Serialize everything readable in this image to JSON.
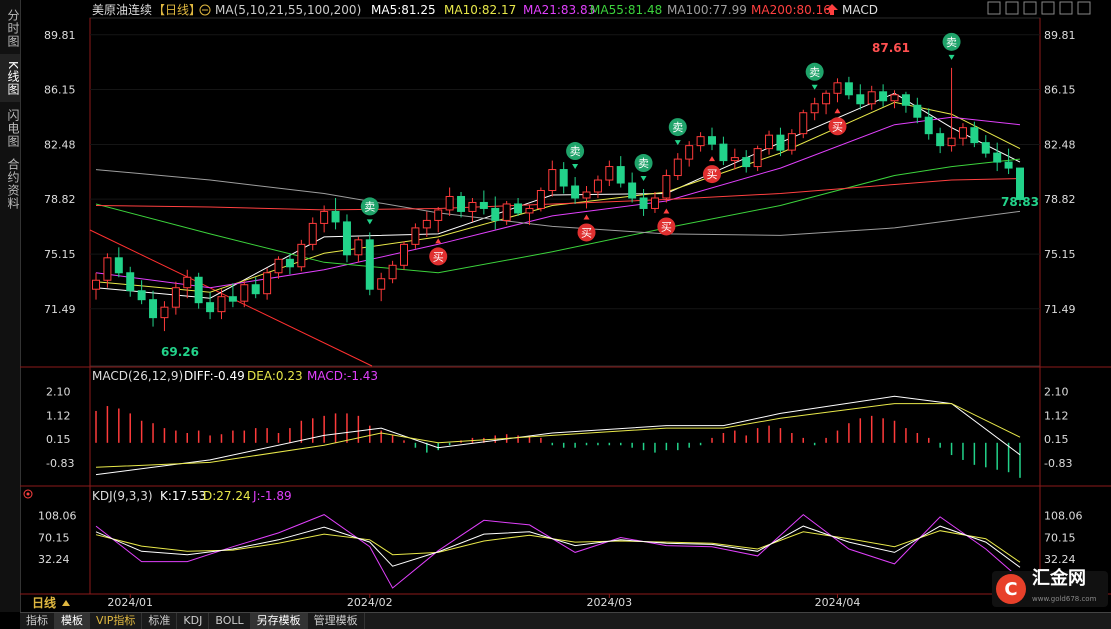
{
  "sidebar": {
    "tabs": [
      "分时图",
      "K线图",
      "闪电图",
      "合约资料"
    ]
  },
  "header": {
    "title": "美原油连续",
    "period_tag": "【日线】",
    "ma_label": "MA(5,10,21,55,100,200)",
    "ma5": "MA5:81.25",
    "ma10": "MA10:82.17",
    "ma21": "MA21:83.83",
    "ma55": "MA55:81.48",
    "ma100": "MA100:77.99",
    "ma200": "MA200:80.16",
    "indicator": "MACD"
  },
  "macd_header": {
    "label": "MACD(26,12,9)",
    "diff": "DIFF:-0.49",
    "dea": "DEA:0.23",
    "macd": "MACD:-1.43"
  },
  "kdj_header": {
    "label": "KDJ(9,3,3)",
    "k": "K:17.53",
    "d": "D:27.24",
    "j": "J:-1.89"
  },
  "footer": {
    "period": "日线",
    "tabs": [
      "指标",
      "模板",
      "VIP指标",
      "标准",
      "KDJ",
      "BOLL",
      "另存模板",
      "管理模板"
    ]
  },
  "logo": {
    "name": "汇金网",
    "url": "www.gold678.com"
  },
  "colors": {
    "up": "#ff3b3b",
    "down": "#22d38a",
    "ma5": "#ffffff",
    "ma10": "#e8e84a",
    "ma21": "#e040fb",
    "ma55": "#3cd23c",
    "ma100": "#9e9e9e",
    "ma200": "#ff4040"
  },
  "chart_data": [
    {
      "type": "candlestick",
      "title": "美原油连续【日线】",
      "x_ticks": [
        "2024/01",
        "2024/02",
        "2024/03",
        "2024/04"
      ],
      "y_ticks": [
        89.81,
        86.15,
        82.48,
        78.82,
        75.15,
        71.49
      ],
      "ylim": [
        67.8,
        90.8
      ],
      "annotations": {
        "high": "87.61",
        "low": "69.26",
        "last": "78.83"
      },
      "buy_label": "买",
      "sell_label": "卖",
      "signals": [
        {
          "i": 24,
          "t": "sell"
        },
        {
          "i": 30,
          "t": "buy"
        },
        {
          "i": 42,
          "t": "sell"
        },
        {
          "i": 43,
          "t": "buy"
        },
        {
          "i": 48,
          "t": "sell"
        },
        {
          "i": 50,
          "t": "buy"
        },
        {
          "i": 51,
          "t": "sell"
        },
        {
          "i": 54,
          "t": "buy"
        },
        {
          "i": 63,
          "t": "sell"
        },
        {
          "i": 65,
          "t": "buy"
        },
        {
          "i": 75,
          "t": "sell"
        }
      ],
      "candles": [
        [
          72.8,
          73.9,
          72.1,
          73.4
        ],
        [
          73.4,
          75.2,
          72.9,
          74.9
        ],
        [
          74.9,
          75.6,
          73.6,
          73.9
        ],
        [
          73.9,
          74.3,
          72.3,
          72.7
        ],
        [
          72.7,
          73.4,
          71.8,
          72.1
        ],
        [
          72.1,
          72.7,
          70.3,
          70.9
        ],
        [
          70.9,
          72.0,
          70.0,
          71.6
        ],
        [
          71.6,
          73.3,
          71.1,
          72.9
        ],
        [
          72.9,
          74.1,
          72.2,
          73.6
        ],
        [
          73.6,
          73.9,
          71.5,
          71.9
        ],
        [
          71.9,
          72.6,
          70.8,
          71.3
        ],
        [
          71.3,
          72.8,
          70.8,
          72.3
        ],
        [
          72.3,
          73.2,
          71.6,
          72.0
        ],
        [
          72.0,
          73.4,
          71.6,
          73.1
        ],
        [
          73.1,
          73.6,
          72.2,
          72.5
        ],
        [
          72.5,
          74.2,
          72.1,
          73.9
        ],
        [
          73.9,
          75.0,
          73.5,
          74.8
        ],
        [
          74.8,
          75.2,
          73.8,
          74.3
        ],
        [
          74.3,
          76.1,
          74.0,
          75.8
        ],
        [
          75.8,
          77.6,
          75.4,
          77.2
        ],
        [
          77.2,
          78.4,
          76.6,
          78.0
        ],
        [
          78.0,
          78.9,
          76.8,
          77.3
        ],
        [
          77.3,
          77.8,
          74.6,
          75.1
        ],
        [
          75.1,
          76.3,
          74.6,
          76.1
        ],
        [
          76.1,
          76.6,
          72.4,
          72.8
        ],
        [
          72.8,
          73.9,
          72.0,
          73.5
        ],
        [
          73.5,
          74.7,
          73.2,
          74.4
        ],
        [
          74.4,
          76.0,
          74.1,
          75.8
        ],
        [
          75.8,
          77.2,
          75.5,
          76.9
        ],
        [
          76.9,
          78.0,
          76.3,
          77.4
        ],
        [
          77.4,
          78.3,
          76.6,
          78.1
        ],
        [
          78.1,
          79.6,
          77.7,
          79.0
        ],
        [
          79.0,
          79.3,
          77.6,
          78.0
        ],
        [
          78.0,
          78.9,
          77.3,
          78.6
        ],
        [
          78.6,
          79.4,
          77.8,
          78.2
        ],
        [
          78.2,
          79.0,
          76.8,
          77.4
        ],
        [
          77.4,
          78.7,
          77.1,
          78.5
        ],
        [
          78.5,
          78.9,
          77.7,
          77.9
        ],
        [
          77.9,
          78.4,
          77.1,
          78.2
        ],
        [
          78.2,
          79.6,
          78.0,
          79.4
        ],
        [
          79.4,
          81.4,
          79.0,
          80.8
        ],
        [
          80.8,
          81.3,
          79.2,
          79.7
        ],
        [
          79.7,
          80.3,
          78.5,
          78.9
        ],
        [
          78.9,
          79.7,
          78.2,
          79.3
        ],
        [
          79.3,
          80.4,
          78.9,
          80.1
        ],
        [
          80.1,
          81.4,
          79.7,
          81.0
        ],
        [
          81.0,
          81.7,
          79.6,
          79.9
        ],
        [
          79.9,
          80.6,
          78.6,
          78.9
        ],
        [
          78.9,
          79.5,
          77.7,
          78.2
        ],
        [
          78.2,
          79.3,
          77.9,
          78.9
        ],
        [
          78.9,
          80.8,
          78.6,
          80.4
        ],
        [
          80.4,
          81.9,
          80.1,
          81.5
        ],
        [
          81.5,
          82.7,
          81.0,
          82.4
        ],
        [
          82.4,
          83.3,
          82.0,
          83.0
        ],
        [
          83.0,
          83.6,
          82.1,
          82.5
        ],
        [
          82.5,
          83.0,
          81.1,
          81.4
        ],
        [
          81.4,
          82.2,
          80.8,
          81.6
        ],
        [
          81.6,
          82.1,
          80.6,
          81.0
        ],
        [
          81.0,
          82.4,
          80.7,
          82.2
        ],
        [
          82.2,
          83.4,
          81.8,
          83.1
        ],
        [
          83.1,
          83.6,
          81.7,
          82.1
        ],
        [
          82.1,
          83.5,
          81.8,
          83.2
        ],
        [
          83.2,
          84.8,
          82.9,
          84.6
        ],
        [
          84.6,
          85.6,
          84.1,
          85.2
        ],
        [
          85.2,
          86.1,
          84.5,
          85.9
        ],
        [
          85.9,
          86.9,
          85.3,
          86.6
        ],
        [
          86.6,
          87.0,
          85.5,
          85.8
        ],
        [
          85.8,
          86.5,
          84.8,
          85.2
        ],
        [
          85.2,
          86.4,
          84.8,
          86.0
        ],
        [
          86.0,
          86.5,
          85.0,
          85.4
        ],
        [
          85.4,
          86.1,
          84.9,
          85.8
        ],
        [
          85.8,
          86.0,
          84.6,
          85.1
        ],
        [
          85.1,
          85.6,
          83.9,
          84.3
        ],
        [
          84.3,
          84.9,
          82.8,
          83.2
        ],
        [
          83.2,
          83.6,
          81.9,
          82.4
        ],
        [
          82.4,
          87.6,
          82.0,
          82.9
        ],
        [
          82.9,
          83.9,
          82.4,
          83.6
        ],
        [
          83.6,
          84.0,
          82.3,
          82.6
        ],
        [
          82.6,
          83.1,
          81.6,
          81.9
        ],
        [
          81.9,
          82.6,
          80.7,
          81.3
        ],
        [
          81.3,
          82.2,
          80.5,
          80.9
        ],
        [
          80.9,
          79.3,
          78.6,
          78.8
        ]
      ],
      "ma_lines": {
        "MA5": [
          [
            0,
            72.9
          ],
          [
            10,
            72.2
          ],
          [
            20,
            76.3
          ],
          [
            30,
            76.5
          ],
          [
            40,
            79.1
          ],
          [
            50,
            79.2
          ],
          [
            60,
            82.6
          ],
          [
            70,
            85.9
          ],
          [
            75,
            83.6
          ],
          [
            81,
            81.3
          ]
        ],
        "MA10": [
          [
            0,
            73.3
          ],
          [
            10,
            72.6
          ],
          [
            20,
            75.2
          ],
          [
            30,
            76.3
          ],
          [
            40,
            78.4
          ],
          [
            50,
            79.3
          ],
          [
            60,
            81.9
          ],
          [
            70,
            85.3
          ],
          [
            75,
            84.5
          ],
          [
            81,
            82.2
          ]
        ],
        "MA21": [
          [
            0,
            73.9
          ],
          [
            10,
            72.9
          ],
          [
            20,
            74.1
          ],
          [
            30,
            75.8
          ],
          [
            40,
            77.7
          ],
          [
            50,
            78.7
          ],
          [
            60,
            80.9
          ],
          [
            70,
            83.8
          ],
          [
            75,
            84.3
          ],
          [
            81,
            83.8
          ]
        ],
        "MA55": [
          [
            0,
            78.5
          ],
          [
            10,
            76.5
          ],
          [
            20,
            74.6
          ],
          [
            30,
            73.9
          ],
          [
            40,
            75.3
          ],
          [
            50,
            76.9
          ],
          [
            60,
            78.4
          ],
          [
            70,
            80.4
          ],
          [
            75,
            81.0
          ],
          [
            81,
            81.5
          ]
        ],
        "MA100": [
          [
            0,
            80.8
          ],
          [
            10,
            80.1
          ],
          [
            20,
            79.2
          ],
          [
            30,
            77.9
          ],
          [
            40,
            77.0
          ],
          [
            50,
            76.5
          ],
          [
            60,
            76.4
          ],
          [
            70,
            76.9
          ],
          [
            75,
            77.4
          ],
          [
            81,
            78.0
          ]
        ],
        "MA200": [
          [
            0,
            78.4
          ],
          [
            10,
            78.3
          ],
          [
            20,
            78.1
          ],
          [
            30,
            78.2
          ],
          [
            40,
            78.5
          ],
          [
            50,
            78.8
          ],
          [
            60,
            79.2
          ],
          [
            70,
            79.8
          ],
          [
            75,
            80.1
          ],
          [
            81,
            80.2
          ]
        ]
      }
    },
    {
      "type": "bar",
      "title": "MACD(26,12,9)",
      "y_ticks": [
        2.1,
        1.12,
        0.15,
        -0.83
      ],
      "ylim": [
        -1.6,
        2.4
      ],
      "macd": [
        1.3,
        1.5,
        1.4,
        1.2,
        0.9,
        0.8,
        0.6,
        0.5,
        0.4,
        0.5,
        0.3,
        0.35,
        0.5,
        0.5,
        0.6,
        0.6,
        0.4,
        0.6,
        0.9,
        1.0,
        1.1,
        1.2,
        1.2,
        1.1,
        0.7,
        0.5,
        0.3,
        0.1,
        -0.2,
        -0.4,
        -0.3,
        -0.1,
        0.1,
        0.2,
        0.2,
        0.3,
        0.35,
        0.3,
        0.3,
        0.2,
        -0.1,
        -0.2,
        -0.2,
        -0.1,
        -0.1,
        -0.1,
        -0.1,
        -0.2,
        -0.3,
        -0.4,
        -0.3,
        -0.3,
        -0.2,
        -0.1,
        0.2,
        0.4,
        0.5,
        0.3,
        0.6,
        0.7,
        0.6,
        0.4,
        0.2,
        -0.1,
        0.2,
        0.5,
        0.8,
        1.0,
        1.1,
        1.0,
        0.9,
        0.6,
        0.4,
        0.2,
        -0.2,
        -0.5,
        -0.7,
        -0.9,
        -1.0,
        -1.1,
        -1.2,
        -1.43
      ],
      "diff": [
        [
          0,
          -1.3
        ],
        [
          10,
          -0.7
        ],
        [
          20,
          0.3
        ],
        [
          25,
          0.6
        ],
        [
          30,
          -0.2
        ],
        [
          40,
          0.4
        ],
        [
          50,
          0.7
        ],
        [
          55,
          0.7
        ],
        [
          60,
          1.2
        ],
        [
          70,
          1.9
        ],
        [
          75,
          1.6
        ],
        [
          81,
          -0.49
        ]
      ],
      "dea": [
        [
          0,
          -1.0
        ],
        [
          10,
          -0.8
        ],
        [
          20,
          -0.1
        ],
        [
          25,
          0.4
        ],
        [
          30,
          0.0
        ],
        [
          40,
          0.3
        ],
        [
          50,
          0.6
        ],
        [
          55,
          0.6
        ],
        [
          60,
          1.0
        ],
        [
          70,
          1.6
        ],
        [
          75,
          1.6
        ],
        [
          81,
          0.23
        ]
      ]
    },
    {
      "type": "line",
      "title": "KDJ(9,3,3)",
      "y_ticks": [
        108.06,
        70.15,
        32.24
      ],
      "ylim": [
        -25,
        125
      ],
      "K": [
        [
          0,
          80
        ],
        [
          4,
          46
        ],
        [
          8,
          40
        ],
        [
          12,
          50
        ],
        [
          16,
          66
        ],
        [
          20,
          88
        ],
        [
          24,
          62
        ],
        [
          26,
          20
        ],
        [
          30,
          45
        ],
        [
          34,
          76
        ],
        [
          38,
          80
        ],
        [
          42,
          56
        ],
        [
          46,
          66
        ],
        [
          50,
          60
        ],
        [
          54,
          58
        ],
        [
          58,
          46
        ],
        [
          62,
          90
        ],
        [
          66,
          62
        ],
        [
          70,
          44
        ],
        [
          74,
          90
        ],
        [
          78,
          62
        ],
        [
          81,
          18
        ]
      ],
      "D": [
        [
          0,
          75
        ],
        [
          4,
          55
        ],
        [
          8,
          46
        ],
        [
          12,
          48
        ],
        [
          16,
          60
        ],
        [
          20,
          76
        ],
        [
          24,
          66
        ],
        [
          26,
          40
        ],
        [
          30,
          44
        ],
        [
          34,
          64
        ],
        [
          38,
          74
        ],
        [
          42,
          62
        ],
        [
          46,
          64
        ],
        [
          50,
          62
        ],
        [
          54,
          60
        ],
        [
          58,
          50
        ],
        [
          62,
          80
        ],
        [
          66,
          68
        ],
        [
          70,
          54
        ],
        [
          74,
          82
        ],
        [
          78,
          68
        ],
        [
          81,
          27
        ]
      ],
      "J": [
        [
          0,
          90
        ],
        [
          4,
          28
        ],
        [
          8,
          28
        ],
        [
          12,
          54
        ],
        [
          16,
          78
        ],
        [
          20,
          110
        ],
        [
          24,
          54
        ],
        [
          26,
          -18
        ],
        [
          30,
          47
        ],
        [
          34,
          100
        ],
        [
          38,
          92
        ],
        [
          42,
          44
        ],
        [
          46,
          70
        ],
        [
          50,
          56
        ],
        [
          54,
          54
        ],
        [
          58,
          38
        ],
        [
          62,
          110
        ],
        [
          66,
          50
        ],
        [
          70,
          24
        ],
        [
          74,
          106
        ],
        [
          78,
          50
        ],
        [
          81,
          -2
        ]
      ]
    }
  ]
}
